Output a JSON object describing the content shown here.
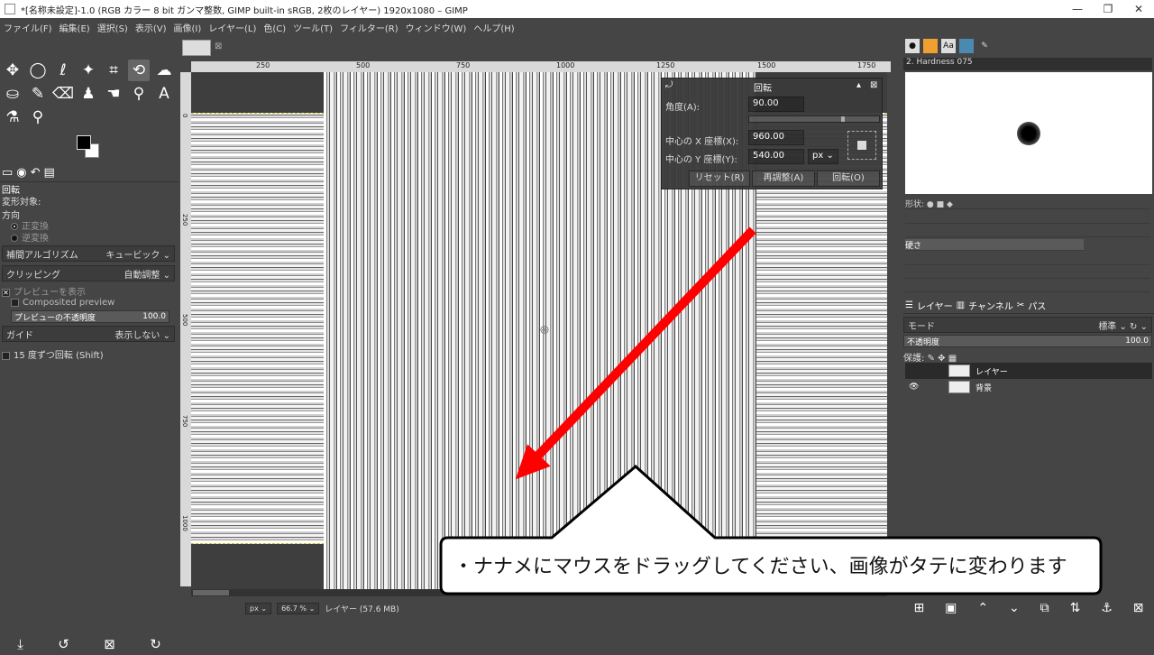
{
  "window": {
    "title": "*[名称未設定]-1.0 (RGB カラー 8 bit ガンマ整数, GIMP built-in sRGB, 2枚のレイヤー) 1920x1080 – GIMP",
    "minimize": "—",
    "restore": "❐",
    "close": "✕"
  },
  "menu": [
    "ファイル(F)",
    "編集(E)",
    "選択(S)",
    "表示(V)",
    "画像(I)",
    "レイヤー(L)",
    "色(C)",
    "ツール(T)",
    "フィルター(R)",
    "ウィンドウ(W)",
    "ヘルプ(H)"
  ],
  "toolbox": {
    "icons": [
      "move-icon",
      "ellipse-select-icon",
      "free-select-icon",
      "fuzzy-select-icon",
      "crop-icon",
      "unified-transform-icon",
      "warp-icon",
      "bucket-fill-icon",
      "paintbrush-icon",
      "eraser-icon",
      "clone-icon",
      "smudge-icon",
      "dodge-icon",
      "text-icon",
      "color-picker-icon",
      "zoom-icon"
    ]
  },
  "tool_options": {
    "title": "回転",
    "transform_label": "変形対象:",
    "direction_label": "方向",
    "direction_options": [
      "正変換",
      "逆変換"
    ],
    "interpolation_label": "補間アルゴリズム",
    "interpolation_value": "キュービック",
    "clipping_label": "クリッピング",
    "clipping_value": "自動調整",
    "show_preview": "プレビューを表示",
    "composited_preview": "Composited preview",
    "preview_opacity_label": "プレビューの不透明度",
    "preview_opacity_value": "100.0",
    "guides_label": "ガイド",
    "guides_value": "表示しない",
    "snap_15": "15 度ずつ回転 (Shift)"
  },
  "canvas": {
    "ruler_ticks": [
      "250",
      "500",
      "750",
      "1000",
      "1250",
      "1500",
      "1750"
    ],
    "vruler_ticks": [
      "0",
      "250",
      "500",
      "750",
      "1000"
    ],
    "unit": "px",
    "zoom": "66.7 %",
    "status": "レイヤー (57.6 MB)"
  },
  "rotate_dialog": {
    "title": "回転",
    "angle_label": "角度(A):",
    "angle_value": "90.00",
    "center_x_label": "中心の X 座標(X):",
    "center_x_value": "960.00",
    "center_y_label": "中心の Y 座標(Y):",
    "center_y_value": "540.00",
    "unit": "px",
    "reset_button": "リセット(R)",
    "readjust_button": "再調整(A)",
    "rotate_button": "回転(O)"
  },
  "right_dock": {
    "brush_name": "2. Hardness 075",
    "shape_label": "形状:",
    "hardness_label": "硬さ",
    "layers_tab": "レイヤー",
    "channels_tab": "チャンネル",
    "paths_tab": "パス",
    "mode_label": "モード",
    "mode_value": "標準",
    "opacity_label": "不透明度",
    "opacity_value": "100.0",
    "lock_label": "保護:",
    "layers": [
      {
        "name": "レイヤー"
      },
      {
        "name": "背景"
      }
    ]
  },
  "annotation": {
    "text": "・ナナメにマウスをドラッグしてください、画像がタテに変わります",
    "arrow_color": "#ff0000"
  }
}
